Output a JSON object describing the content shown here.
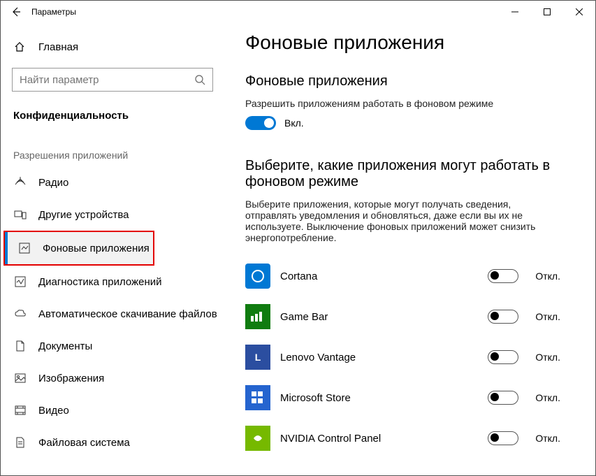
{
  "titlebar": {
    "title": "Параметры"
  },
  "sidebar": {
    "home": "Главная",
    "search_placeholder": "Найти параметр",
    "section": "Конфиденциальность",
    "subsection": "Разрешения приложений",
    "items": [
      {
        "label": "Радио"
      },
      {
        "label": "Другие устройства"
      },
      {
        "label": "Фоновые приложения"
      },
      {
        "label": "Диагностика приложений"
      },
      {
        "label": "Автоматическое скачивание файлов"
      },
      {
        "label": "Документы"
      },
      {
        "label": "Изображения"
      },
      {
        "label": "Видео"
      },
      {
        "label": "Файловая система"
      }
    ]
  },
  "content": {
    "page_title": "Фоновые приложения",
    "master_heading": "Фоновые приложения",
    "master_desc": "Разрешить приложениям работать в фоновом режиме",
    "master_state": "Вкл.",
    "apps_heading": "Выберите, какие приложения могут работать в фоновом режиме",
    "apps_desc": "Выберите приложения, которые могут получать сведения, отправлять уведомления и обновляться, даже если вы их не используете. Выключение фоновых приложений может снизить энергопотребление.",
    "off_label": "Откл.",
    "apps": [
      {
        "name": "Cortana",
        "state": "Откл."
      },
      {
        "name": "Game Bar",
        "state": "Откл."
      },
      {
        "name": "Lenovo Vantage",
        "state": "Откл."
      },
      {
        "name": "Microsoft Store",
        "state": "Откл."
      },
      {
        "name": "NVIDIA Control Panel",
        "state": "Откл."
      }
    ]
  }
}
